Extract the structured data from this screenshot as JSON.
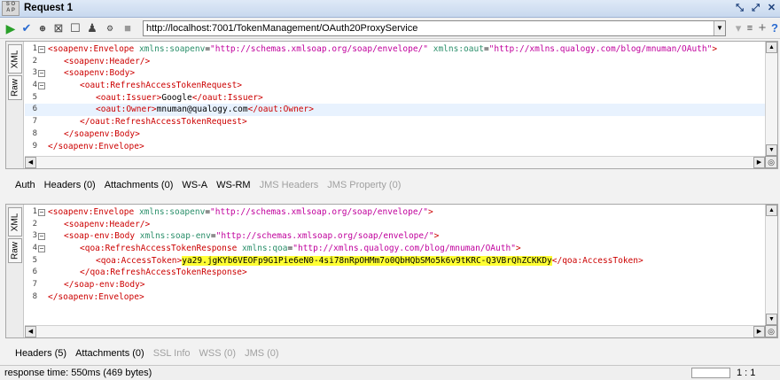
{
  "window": {
    "logo_top": "S O",
    "logo_bottom": "A P",
    "title": "Request 1",
    "controls": [
      "⤡",
      "⤢",
      "✕"
    ]
  },
  "toolbar": {
    "url": "http://localhost:7001/TokenManagement/OAuth20ProxyService",
    "url_dropdown": "▼",
    "add": "+",
    "help": "?"
  },
  "request_editor": {
    "tabs": [
      "XML",
      "Raw"
    ],
    "lines": [
      {
        "n": "1",
        "fold": "−",
        "indent": 0,
        "parts": [
          [
            "tag",
            "<soapenv:Envelope "
          ],
          [
            "attr",
            "xmlns:soapenv"
          ],
          [
            "txt",
            "="
          ],
          [
            "val",
            "\"http://schemas.xmlsoap.org/soap/envelope/\""
          ],
          [
            "txt",
            " "
          ],
          [
            "attr",
            "xmlns:oaut"
          ],
          [
            "txt",
            "="
          ],
          [
            "val",
            "\"http://xmlns.qualogy.com/blog/mnuman/OAuth\""
          ],
          [
            "tag",
            ">"
          ]
        ]
      },
      {
        "n": "2",
        "fold": "",
        "indent": 1,
        "parts": [
          [
            "tag",
            "<soapenv:Header/>"
          ]
        ]
      },
      {
        "n": "3",
        "fold": "−",
        "indent": 1,
        "parts": [
          [
            "tag",
            "<soapenv:Body>"
          ]
        ]
      },
      {
        "n": "4",
        "fold": "−",
        "indent": 2,
        "parts": [
          [
            "tag",
            "<oaut:RefreshAccessTokenRequest>"
          ]
        ]
      },
      {
        "n": "5",
        "fold": "",
        "indent": 3,
        "parts": [
          [
            "tag",
            "<oaut:Issuer>"
          ],
          [
            "txt",
            "Google"
          ],
          [
            "tag",
            "</oaut:Issuer>"
          ]
        ]
      },
      {
        "n": "6",
        "fold": "",
        "indent": 3,
        "active": true,
        "parts": [
          [
            "tag",
            "<oaut:Owner>"
          ],
          [
            "txt",
            "mnuman@qualogy.com"
          ],
          [
            "tag",
            "</oaut:Owner>"
          ]
        ]
      },
      {
        "n": "7",
        "fold": "",
        "indent": 2,
        "parts": [
          [
            "tag",
            "</oaut:RefreshAccessTokenRequest>"
          ]
        ]
      },
      {
        "n": "8",
        "fold": "",
        "indent": 1,
        "parts": [
          [
            "tag",
            "</soapenv:Body>"
          ]
        ]
      },
      {
        "n": "9",
        "fold": "",
        "indent": 0,
        "parts": [
          [
            "tag",
            "</soapenv:Envelope>"
          ]
        ]
      }
    ]
  },
  "request_tabs": [
    {
      "label": "Auth",
      "enabled": true
    },
    {
      "label": "Headers (0)",
      "enabled": true
    },
    {
      "label": "Attachments (0)",
      "enabled": true
    },
    {
      "label": "WS-A",
      "enabled": true
    },
    {
      "label": "WS-RM",
      "enabled": true
    },
    {
      "label": "JMS Headers",
      "enabled": false
    },
    {
      "label": "JMS Property (0)",
      "enabled": false
    }
  ],
  "response_editor": {
    "tabs": [
      "XML",
      "Raw"
    ],
    "lines": [
      {
        "n": "1",
        "fold": "−",
        "indent": 0,
        "parts": [
          [
            "tag",
            "<soapenv:Envelope "
          ],
          [
            "attr",
            "xmlns:soapenv"
          ],
          [
            "txt",
            "="
          ],
          [
            "val",
            "\"http://schemas.xmlsoap.org/soap/envelope/\""
          ],
          [
            "tag",
            ">"
          ]
        ]
      },
      {
        "n": "2",
        "fold": "",
        "indent": 1,
        "parts": [
          [
            "tag",
            "<soapenv:Header/>"
          ]
        ]
      },
      {
        "n": "3",
        "fold": "−",
        "indent": 1,
        "parts": [
          [
            "tag",
            "<soap-env:Body "
          ],
          [
            "attr",
            "xmlns:soap-env"
          ],
          [
            "txt",
            "="
          ],
          [
            "val",
            "\"http://schemas.xmlsoap.org/soap/envelope/\""
          ],
          [
            "tag",
            ">"
          ]
        ]
      },
      {
        "n": "4",
        "fold": "−",
        "indent": 2,
        "parts": [
          [
            "tag",
            "<qoa:RefreshAccessTokenResponse "
          ],
          [
            "attr",
            "xmlns:qoa"
          ],
          [
            "txt",
            "="
          ],
          [
            "val",
            "\"http://xmlns.qualogy.com/blog/mnuman/OAuth\""
          ],
          [
            "tag",
            ">"
          ]
        ]
      },
      {
        "n": "5",
        "fold": "",
        "indent": 3,
        "parts": [
          [
            "tag",
            "<qoa:AccessToken>"
          ],
          [
            "hl",
            "ya29.jgKYb6VEOFp9G1Pie6eN0-4si78nRpOHMm7o0QbHQbSMo5k6v9tKRC-Q3VBrQhZCKKDy"
          ],
          [
            "tag",
            "</qoa:AccessToken>"
          ]
        ]
      },
      {
        "n": "6",
        "fold": "",
        "indent": 2,
        "parts": [
          [
            "tag",
            "</qoa:RefreshAccessTokenResponse>"
          ]
        ]
      },
      {
        "n": "7",
        "fold": "",
        "indent": 1,
        "parts": [
          [
            "tag",
            "</soap-env:Body>"
          ]
        ]
      },
      {
        "n": "8",
        "fold": "",
        "indent": 0,
        "parts": [
          [
            "tag",
            "</soapenv:Envelope>"
          ]
        ]
      }
    ]
  },
  "response_tabs": [
    {
      "label": "Headers (5)",
      "enabled": true
    },
    {
      "label": "Attachments (0)",
      "enabled": true
    },
    {
      "label": "SSL Info",
      "enabled": false
    },
    {
      "label": "WSS (0)",
      "enabled": false
    },
    {
      "label": "JMS (0)",
      "enabled": false
    }
  ],
  "status": {
    "response_time": "response time: 550ms (469 bytes)",
    "cursor_pos": "1 : 1"
  },
  "scroll": {
    "up": "▲",
    "down": "▼",
    "left": "◀",
    "right": "▶",
    "corner": "◎"
  }
}
